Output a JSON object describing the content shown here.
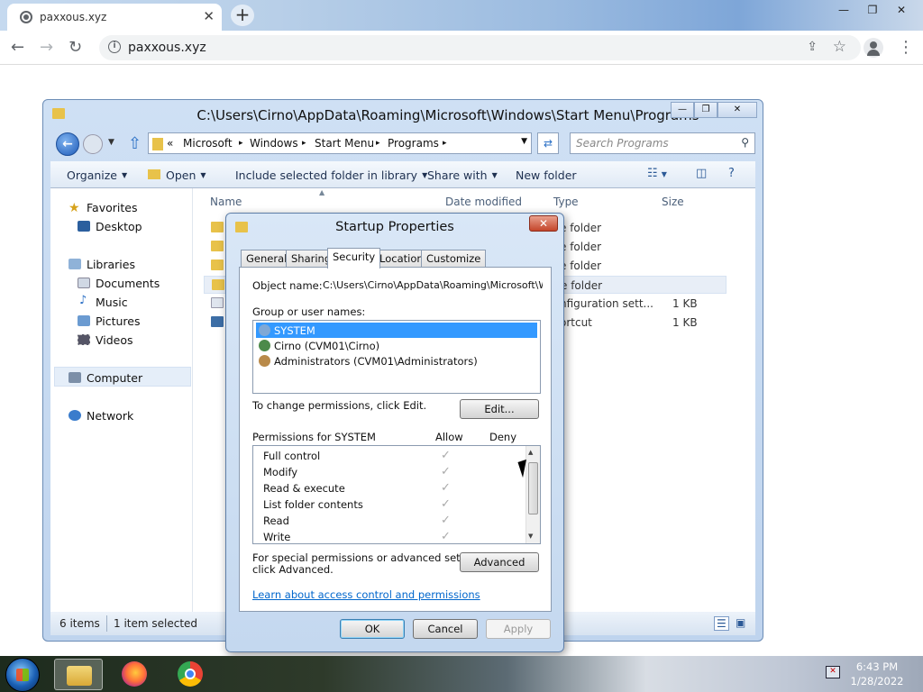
{
  "browser": {
    "tab_title": "paxxous.xyz",
    "tab_close": "✕",
    "new_tab": "+",
    "url": "paxxous.xyz",
    "window_buttons": [
      "—",
      "❐",
      "✕"
    ],
    "back": "←",
    "forward": "→",
    "reload": "↻",
    "share": "⇪",
    "star": "☆",
    "menu": "⋮"
  },
  "explorer": {
    "title": "C:\\Users\\Cirno\\AppData\\Roaming\\Microsoft\\Windows\\Start Menu\\Programs",
    "window_buttons": [
      "—",
      "❐",
      "✕"
    ],
    "breadcrumb": [
      "«",
      "Microsoft",
      "▸",
      "Windows",
      "▸",
      "Start Menu",
      "▸",
      "Programs",
      "▸"
    ],
    "search_placeholder": "Search Programs",
    "commands": {
      "organize": "Organize",
      "open": "Open",
      "include": "Include selected folder in library",
      "share": "Share with",
      "new_folder": "New folder"
    },
    "sidebar": {
      "favorites": "Favorites",
      "desktop": "Desktop",
      "libraries": "Libraries",
      "documents": "Documents",
      "music": "Music",
      "pictures": "Pictures",
      "videos": "Videos",
      "computer": "Computer",
      "network": "Network"
    },
    "columns": {
      "name": "Name",
      "date": "Date modified",
      "type": "Type",
      "size": "Size"
    },
    "rows": [
      {
        "type": "e folder",
        "size": ""
      },
      {
        "type": "e folder",
        "size": ""
      },
      {
        "type": "e folder",
        "size": ""
      },
      {
        "type": "e folder",
        "size": ""
      },
      {
        "type": "nfiguration sett...",
        "size": "1 KB"
      },
      {
        "type": "ortcut",
        "size": "1 KB"
      }
    ],
    "status": {
      "items": "6 items",
      "selected": "1 item selected"
    }
  },
  "dialog": {
    "title": "Startup Properties",
    "close": "✕",
    "tabs": [
      "General",
      "Sharing",
      "Security",
      "Location",
      "Customize"
    ],
    "object_name_label": "Object name:",
    "object_name_value": "C:\\Users\\Cirno\\AppData\\Roaming\\Microsoft\\Wind",
    "group_label": "Group or user names:",
    "users": [
      "SYSTEM",
      "Cirno (CVM01\\Cirno)",
      "Administrators (CVM01\\Administrators)"
    ],
    "change_text": "To change permissions, click Edit.",
    "edit_button": "Edit...",
    "perm_for": "Permissions for SYSTEM",
    "allow": "Allow",
    "deny": "Deny",
    "permissions": [
      "Full control",
      "Modify",
      "Read & execute",
      "List folder contents",
      "Read",
      "Write"
    ],
    "check": "✓",
    "special_text_1": "For special permissions or advanced settings,",
    "special_text_2": "click Advanced.",
    "advanced_button": "Advanced",
    "learn_link": "Learn about access control and permissions",
    "ok": "OK",
    "cancel": "Cancel",
    "apply": "Apply"
  },
  "taskbar": {
    "time": "6:43 PM",
    "date": "1/28/2022"
  }
}
